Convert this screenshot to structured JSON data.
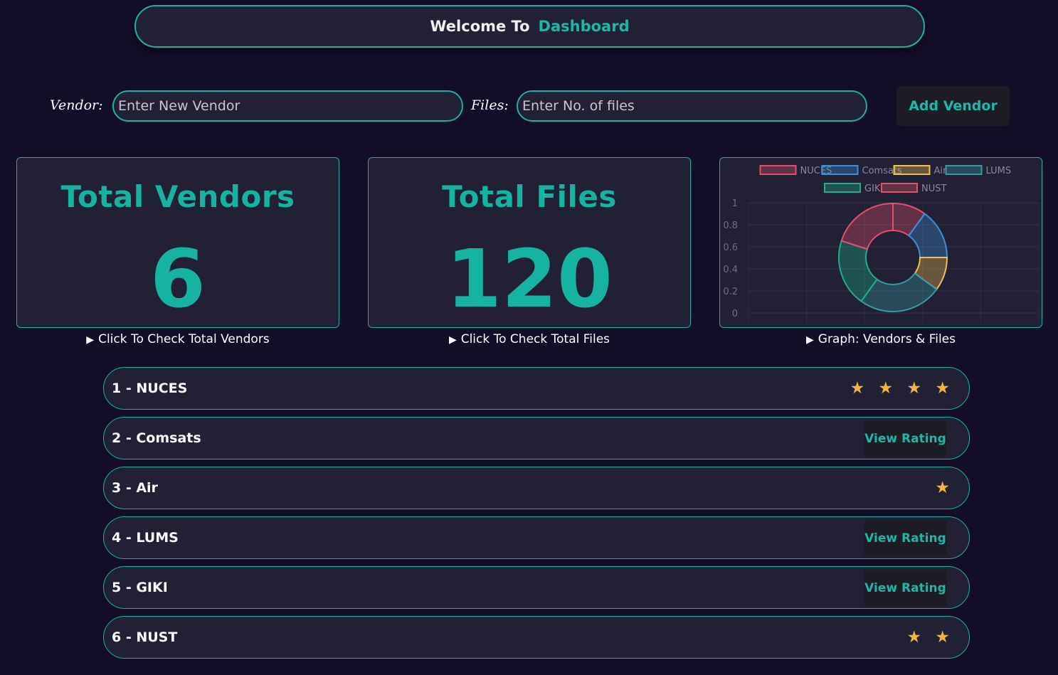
{
  "header": {
    "welcome": "Welcome To",
    "title": "Dashboard"
  },
  "form": {
    "vendor_label": "Vendor:",
    "vendor_placeholder": "Enter New Vendor",
    "files_label": "Files:",
    "files_placeholder": "Enter No. of files",
    "add_button": "Add Vendor"
  },
  "cards": {
    "vendors": {
      "title": "Total Vendors",
      "value": "6",
      "caption": "Click To Check Total Vendors"
    },
    "files": {
      "title": "Total Files",
      "value": "120",
      "caption": "Click To Check Total Files"
    },
    "graph": {
      "caption": "Graph: Vendors & Files"
    }
  },
  "caption_icon": "play-triangle-icon",
  "vendors": [
    {
      "label": "1 - NUCES",
      "stars": "★ ★ ★ ★",
      "view_rating": ""
    },
    {
      "label": "2 - Comsats",
      "stars": "",
      "view_rating": "View Rating"
    },
    {
      "label": "3 - Air",
      "stars": "★",
      "view_rating": ""
    },
    {
      "label": "4 - LUMS",
      "stars": "",
      "view_rating": "View Rating"
    },
    {
      "label": "5 - GIKI",
      "stars": "",
      "view_rating": "View Rating"
    },
    {
      "label": "6 - NUST",
      "stars": "★ ★",
      "view_rating": ""
    }
  ],
  "colors": {
    "accent": "#16b3a3",
    "background": "#130d27",
    "panel": "#212034",
    "star": "#f0b43a"
  },
  "chart_data": {
    "type": "doughnut",
    "labels": [
      "NUCES",
      "Comsats",
      "Air",
      "LUMS",
      "GIKI",
      "NUST"
    ],
    "values": [
      20,
      30,
      20,
      50,
      40,
      40
    ],
    "colors": [
      "#e0506f",
      "#3d8fd9",
      "#f0c050",
      "#3a9aa5",
      "#1fae8a",
      "#e0506f"
    ],
    "ytick_labels": [
      "1",
      "0.8",
      "0.6",
      "0.4",
      "0.2",
      "0"
    ],
    "legend_position": "top",
    "grid": true
  }
}
